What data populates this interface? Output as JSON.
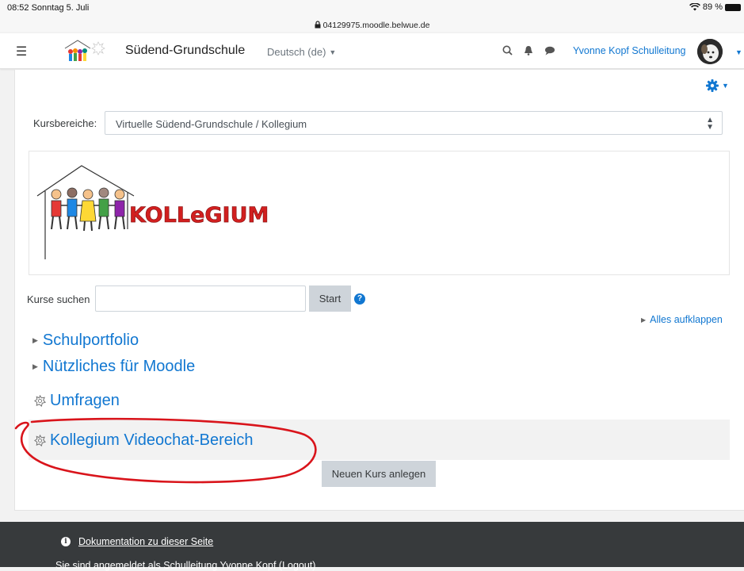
{
  "status_bar": {
    "time_date": "08:52  Sonntag 5. Juli",
    "battery": "89 %",
    "url": "04129975.moodle.belwue.de"
  },
  "navbar": {
    "site_name": "Südend-Grundschule",
    "language": "Deutsch (de)",
    "user_name": "Yvonne Kopf Schulleitung"
  },
  "category_selector": {
    "label": "Kursbereiche:",
    "value": "Virtuelle Südend-Grundschule / Kollegium"
  },
  "category_image": {
    "word": "KOLLeGIUM"
  },
  "course_search": {
    "label": "Kurse suchen",
    "value": "",
    "button": "Start"
  },
  "expand_all": "Alles aufklappen",
  "subcategories": [
    {
      "label": "Schulportfolio"
    },
    {
      "label": "Nützliches für Moodle"
    }
  ],
  "courses": [
    {
      "label": "Umfragen"
    },
    {
      "label": "Kollegium Videochat-Bereich"
    }
  ],
  "new_course_button": "Neuen Kurs anlegen",
  "footer": {
    "doc_link": "Dokumentation zu dieser Seite",
    "logged_in": "Sie sind angemeldet als Schulleitung Yvonne Kopf (Logout)"
  },
  "colors": {
    "link": "#1177d1",
    "button_bg": "#ced4da",
    "footer_bg": "#373a3c",
    "annotation": "#d9141b"
  },
  "icons": [
    "hamburger-icon",
    "search-icon",
    "bell-icon",
    "chat-icon",
    "gear-icon",
    "help-icon",
    "info-icon",
    "course-icon",
    "lock-icon"
  ]
}
